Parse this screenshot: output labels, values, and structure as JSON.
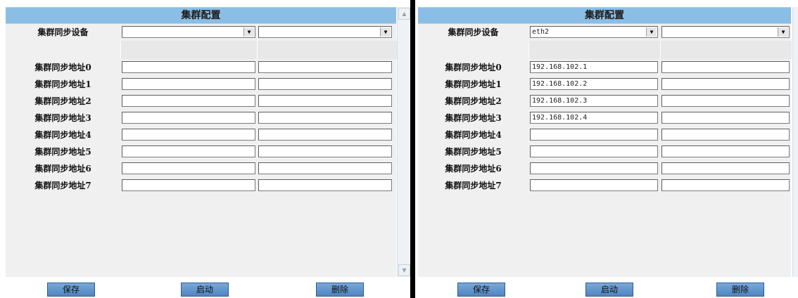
{
  "left_panel": {
    "title": "集群配置",
    "device_label": "集群同步设备",
    "device_values": [
      "",
      ""
    ],
    "addresses": [
      {
        "label": "集群同步地址0",
        "v1": "",
        "v2": ""
      },
      {
        "label": "集群同步地址1",
        "v1": "",
        "v2": ""
      },
      {
        "label": "集群同步地址2",
        "v1": "",
        "v2": ""
      },
      {
        "label": "集群同步地址3",
        "v1": "",
        "v2": ""
      },
      {
        "label": "集群同步地址4",
        "v1": "",
        "v2": ""
      },
      {
        "label": "集群同步地址5",
        "v1": "",
        "v2": ""
      },
      {
        "label": "集群同步地址6",
        "v1": "",
        "v2": ""
      },
      {
        "label": "集群同步地址7",
        "v1": "",
        "v2": ""
      }
    ],
    "buttons": {
      "save": "保存",
      "start": "启动",
      "delete": "删除"
    }
  },
  "right_panel": {
    "title": "集群配置",
    "device_label": "集群同步设备",
    "device_values": [
      "eth2",
      ""
    ],
    "addresses": [
      {
        "label": "集群同步地址0",
        "v1": "192.168.102.1",
        "v2": ""
      },
      {
        "label": "集群同步地址1",
        "v1": "192.168.102.2",
        "v2": ""
      },
      {
        "label": "集群同步地址2",
        "v1": "192.168.102.3",
        "v2": ""
      },
      {
        "label": "集群同步地址3",
        "v1": "192.168.102.4",
        "v2": ""
      },
      {
        "label": "集群同步地址4",
        "v1": "",
        "v2": ""
      },
      {
        "label": "集群同步地址5",
        "v1": "",
        "v2": ""
      },
      {
        "label": "集群同步地址6",
        "v1": "",
        "v2": ""
      },
      {
        "label": "集群同步地址7",
        "v1": "",
        "v2": ""
      }
    ],
    "buttons": {
      "save": "保存",
      "start": "启动",
      "delete": "删除"
    }
  },
  "colors": {
    "title_bar": "#8bbee5",
    "button": "#5b8fcb",
    "divider": "#000000"
  }
}
